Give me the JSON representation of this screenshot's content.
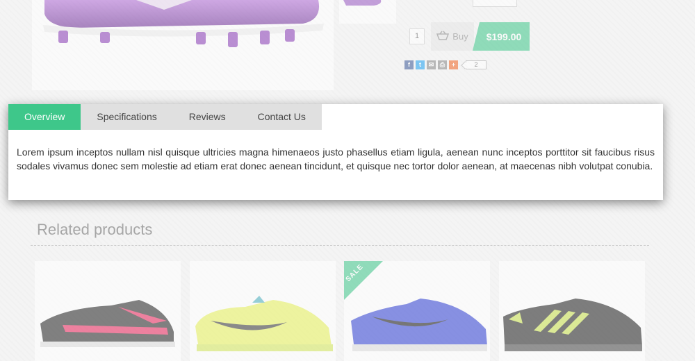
{
  "product": {
    "quantity": "1",
    "buy_label": "Buy",
    "price": "$199.00",
    "share_count": "2",
    "share_icons": [
      "facebook-icon",
      "twitter-icon",
      "email-icon",
      "print-icon",
      "plus-icon"
    ]
  },
  "tabs": [
    {
      "label": "Overview",
      "active": true
    },
    {
      "label": "Specifications",
      "active": false
    },
    {
      "label": "Reviews",
      "active": false
    },
    {
      "label": "Contact Us",
      "active": false
    }
  ],
  "overview_text": "Lorem ipsum inceptos nullam nisl quisque ultricies magna himenaeos justo phasellus etiam ligula, aenean nunc inceptos porttitor sit faucibus risus sodales vivamus donec sem molestie ad etiam erat donec aenean tincidunt, et quisque nec tortor dolor aenean, at maecenas nibh volutpat conubia.",
  "related": {
    "title": "Related products",
    "sale_label": "SALE"
  },
  "colors": {
    "accent": "#3ec78a",
    "tab_inactive": "#e0e0e0"
  }
}
